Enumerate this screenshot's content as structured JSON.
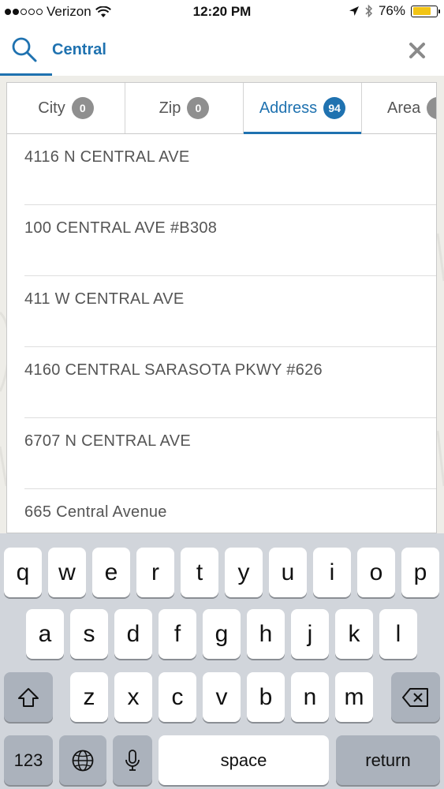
{
  "status_bar": {
    "carrier": "Verizon",
    "time": "12:20 PM",
    "battery": "76%",
    "battery_level": 0.76
  },
  "search": {
    "value": "Central",
    "icons": {
      "search": "search-icon",
      "close": "close-icon"
    },
    "accent_color": "#1f72b0"
  },
  "tabs": [
    {
      "label": "City",
      "count": "0"
    },
    {
      "label": "Zip",
      "count": "0"
    },
    {
      "label": "Address",
      "count": "94",
      "active": true
    },
    {
      "label": "Area",
      "count": ""
    }
  ],
  "results": [
    "4116 N CENTRAL AVE",
    "100 CENTRAL AVE #B308",
    "411 W CENTRAL AVE",
    "4160 CENTRAL SARASOTA PKWY #626",
    "6707 N CENTRAL AVE",
    "665 Central Avenue"
  ],
  "keyboard": {
    "row1": [
      "q",
      "w",
      "e",
      "r",
      "t",
      "y",
      "u",
      "i",
      "o",
      "p"
    ],
    "row2": [
      "a",
      "s",
      "d",
      "f",
      "g",
      "h",
      "j",
      "k",
      "l"
    ],
    "row3": [
      "z",
      "x",
      "c",
      "v",
      "b",
      "n",
      "m"
    ],
    "numbers_label": "123",
    "space_label": "space",
    "return_label": "return",
    "icons": {
      "shift": "shift-icon",
      "delete": "delete-icon",
      "globe": "globe-icon",
      "mic": "microphone-icon"
    }
  }
}
